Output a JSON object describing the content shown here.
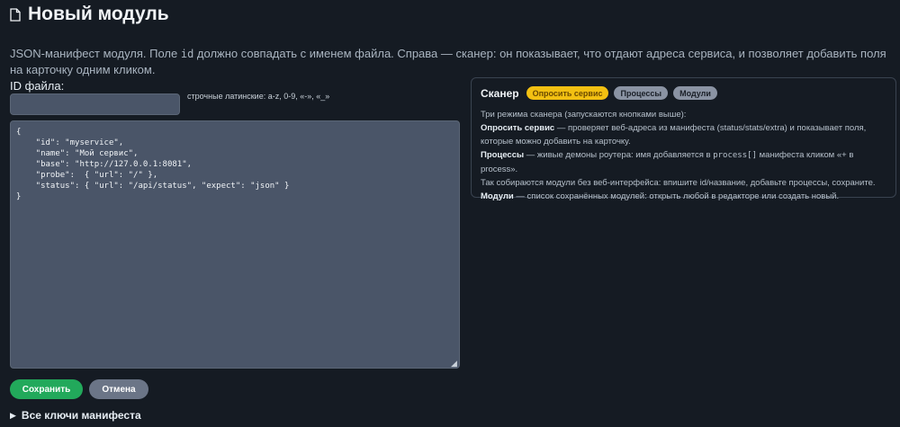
{
  "page": {
    "title": "Новый модуль",
    "description_parts": [
      "JSON-манифест модуля. Поле ",
      "id",
      " должно совпадать с именем файла. Справа — сканер: он показывает, что отдают адреса сервиса, и позволяет добавить поля на карточку одним кликом."
    ]
  },
  "form": {
    "id_label": "ID файла:",
    "id_value": "",
    "id_hint": "строчные латинские: a-z, 0-9, «-», «_»",
    "manifest_text": "{\n    \"id\": \"myservice\",\n    \"name\": \"Мой сервис\",\n    \"base\": \"http://127.0.0.1:8081\",\n    \"probe\":  { \"url\": \"/\" },\n    \"status\": { \"url\": \"/api/status\", \"expect\": \"json\" }\n}",
    "save_label": "Сохранить",
    "cancel_label": "Отмена",
    "all_keys_label": "Все ключи манифеста"
  },
  "scanner": {
    "title": "Сканер",
    "buttons": [
      "Опросить сервис",
      "Процессы",
      "Модули"
    ],
    "intro": "Три режима сканера (запускаются кнопками выше):",
    "poll_name": "Опросить сервис",
    "poll_text": " — проверяет веб-адреса из манифеста (status/stats/extra) и показывает поля, которые можно добавить на карточку.",
    "proc_name": "Процессы",
    "proc_text_a": " — живые демоны роутера: имя добавляется в ",
    "proc_code": "process[]",
    "proc_text_b": " манифеста кликом «+ в process».",
    "proc_text_c": "Так собираются модули без веб-интерфейса: впишите id/название, добавьте процессы, сохраните.",
    "mod_name": "Модули",
    "mod_text": " — список сохранённых модулей: открыть любой в редакторе или создать новый."
  },
  "colors": {
    "background": "#151b23",
    "save": "#22a95b",
    "cancel": "#6b7587",
    "poll_pill": "#f2c012",
    "gray_pill": "#8a93a3"
  },
  "icons": {
    "title_icon": "document-icon",
    "expander_icon": "triangle-right-icon",
    "resize_icon": "resize-grip-icon"
  }
}
